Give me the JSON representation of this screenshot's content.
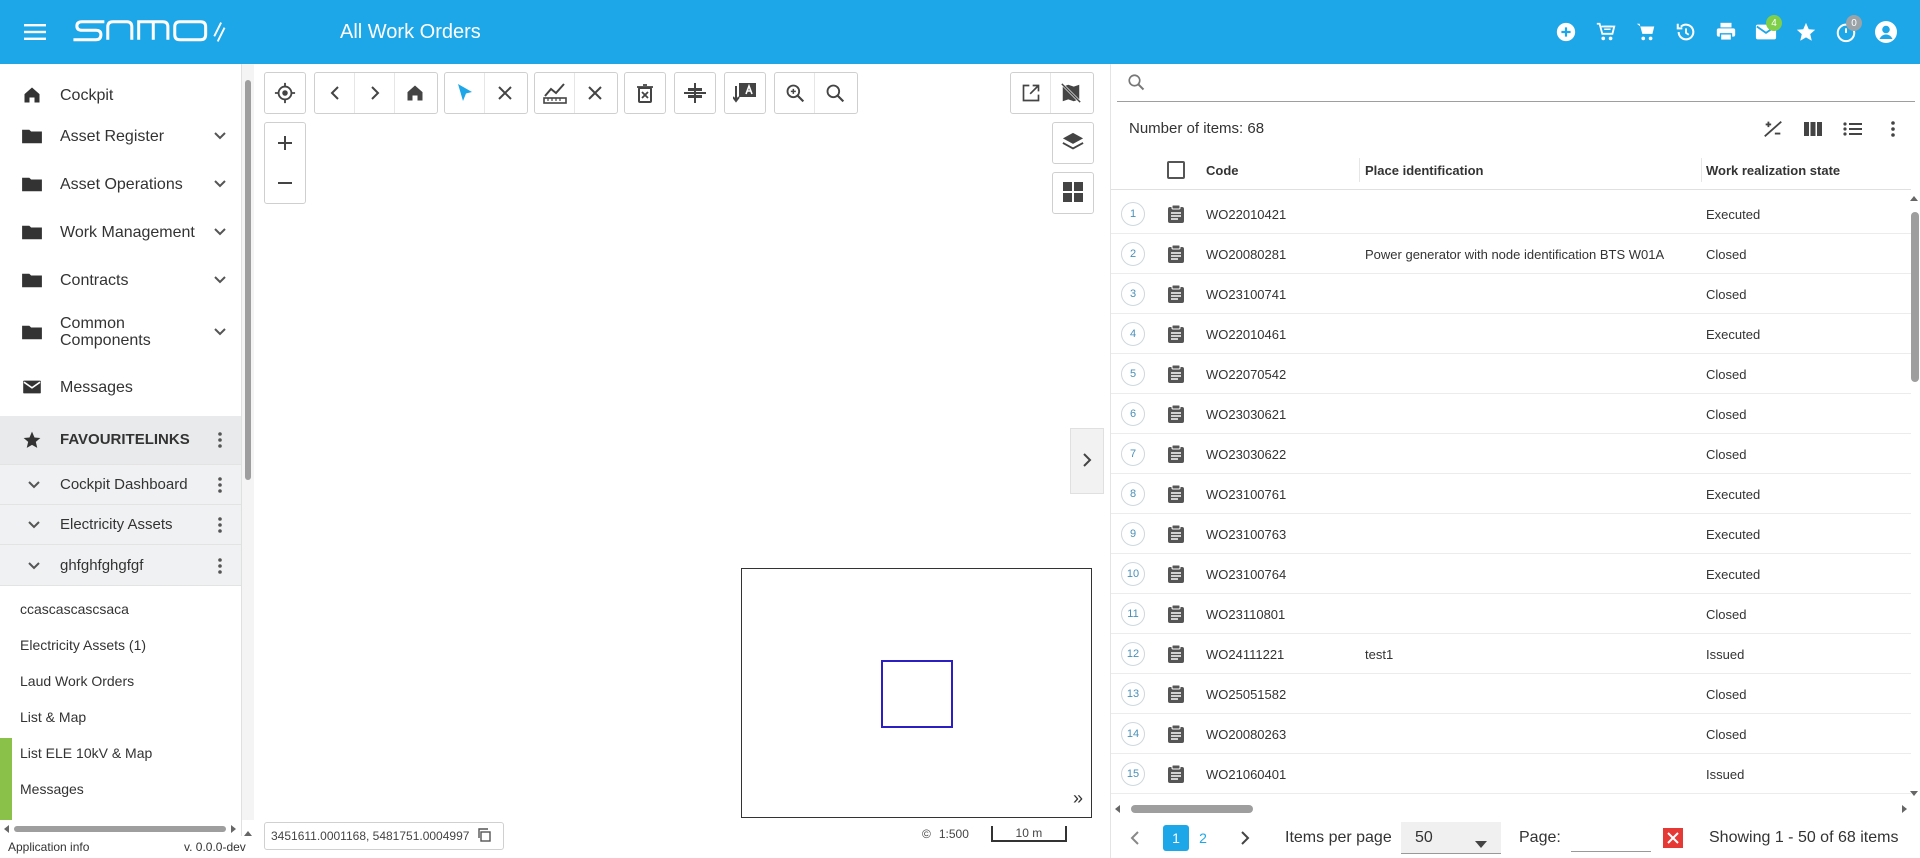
{
  "header": {
    "title": "All Work Orders",
    "logo_text": "samo",
    "badges": {
      "messages": "4",
      "timers": "0"
    },
    "accent": "#1ea7e8"
  },
  "sidebar": {
    "items": [
      {
        "label": "Cockpit",
        "icon": "home-icon"
      },
      {
        "label": "Asset Register",
        "icon": "folder-icon"
      },
      {
        "label": "Asset Operations",
        "icon": "folder-icon"
      },
      {
        "label": "Work Management",
        "icon": "folder-icon"
      },
      {
        "label": "Contracts",
        "icon": "folder-icon"
      },
      {
        "label": "Common Components",
        "icon": "folder-icon"
      },
      {
        "label": "Messages",
        "icon": "mail-icon"
      }
    ],
    "favourites_title": "FAVOURITELINKS",
    "favourite_groups": [
      "Cockpit Dashboard",
      "Electricity Assets",
      "ghfghfghgfgf"
    ],
    "links": [
      "ccascascascsaca",
      "Electricity Assets (1)",
      "Laud Work Orders",
      "List & Map",
      "List ELE 10kV & Map",
      "Messages"
    ],
    "footer": {
      "app_info": "Application info",
      "version": "v. 0.0.0-dev"
    }
  },
  "map": {
    "coordinates": "3451611.0001168, 5481751.0004997",
    "scale": "1:500",
    "scale_bar": "10 m",
    "copyright": "©"
  },
  "grid": {
    "search_placeholder": "",
    "count_label": "Number of items: 68",
    "columns": {
      "code": "Code",
      "place": "Place identification",
      "state": "Work realization state"
    },
    "rows": [
      {
        "n": "1",
        "code": "WO22010421",
        "place": "",
        "state": "Executed"
      },
      {
        "n": "2",
        "code": "WO20080281",
        "place": "Power generator with node identification BTS W01A",
        "state": "Closed"
      },
      {
        "n": "3",
        "code": "WO23100741",
        "place": "",
        "state": "Closed"
      },
      {
        "n": "4",
        "code": "WO22010461",
        "place": "",
        "state": "Executed"
      },
      {
        "n": "5",
        "code": "WO22070542",
        "place": "",
        "state": "Closed"
      },
      {
        "n": "6",
        "code": "WO23030621",
        "place": "",
        "state": "Closed"
      },
      {
        "n": "7",
        "code": "WO23030622",
        "place": "",
        "state": "Closed"
      },
      {
        "n": "8",
        "code": "WO23100761",
        "place": "",
        "state": "Executed"
      },
      {
        "n": "9",
        "code": "WO23100763",
        "place": "",
        "state": "Executed"
      },
      {
        "n": "10",
        "code": "WO23100764",
        "place": "",
        "state": "Executed"
      },
      {
        "n": "11",
        "code": "WO23110801",
        "place": "",
        "state": "Closed"
      },
      {
        "n": "12",
        "code": "WO24111221",
        "place": "test1",
        "state": "Issued"
      },
      {
        "n": "13",
        "code": "WO25051582",
        "place": "",
        "state": "Closed"
      },
      {
        "n": "14",
        "code": "WO20080263",
        "place": "",
        "state": "Closed"
      },
      {
        "n": "15",
        "code": "WO21060401",
        "place": "",
        "state": "Issued"
      }
    ]
  },
  "pager": {
    "pages": [
      "1",
      "2"
    ],
    "items_per_page_label": "Items per page",
    "items_per_page": "50",
    "page_label": "Page:",
    "page_value": "",
    "showing": "Showing 1 - 50 of 68 items"
  }
}
